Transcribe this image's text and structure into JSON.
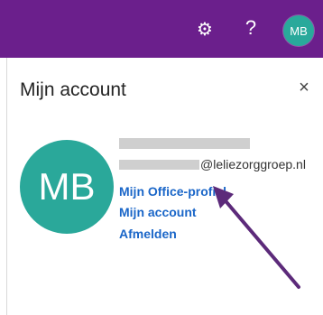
{
  "header": {
    "settings_icon": "gear-icon",
    "help_label": "?",
    "avatar_initials": "MB"
  },
  "panel": {
    "title": "Mijn account",
    "close_label": "×",
    "avatar_initials": "MB",
    "email_visible": "@leliezorggroep.nl",
    "links": {
      "office_profile": "Mijn Office-profiel",
      "my_account": "Mijn account",
      "sign_out": "Afmelden"
    }
  },
  "colors": {
    "header_bg": "#6b1f8c",
    "avatar_bg": "#2aa89a",
    "link": "#1a66c8",
    "annotation_arrow": "#5c2a7a"
  }
}
